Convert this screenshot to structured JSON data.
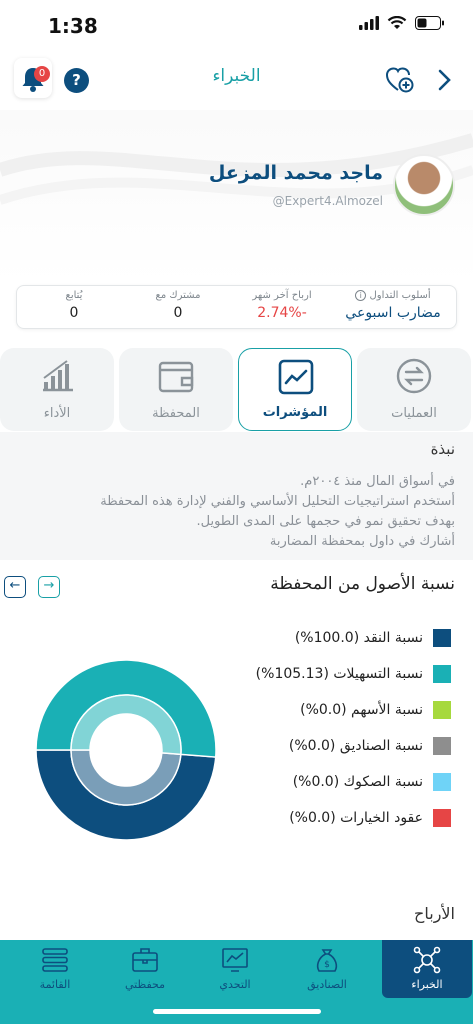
{
  "status_bar": {
    "time": "1:38"
  },
  "header": {
    "title": "الخبراء",
    "notification_count": "0",
    "help_label": "?"
  },
  "expert": {
    "name": "ماجد محمد المزعل",
    "handle": "@Expert4.Almozel"
  },
  "stats": [
    {
      "label": "أسلوب التداول",
      "value": "مضارب اسبوعي"
    },
    {
      "label": "ارباح آخر شهر",
      "value": "-2.74%"
    },
    {
      "label": "مشترك مع",
      "value": "0"
    },
    {
      "label": "يُتابع",
      "value": "0"
    }
  ],
  "tabs": [
    {
      "label": "العمليات",
      "icon": "exchange-icon"
    },
    {
      "label": "المؤشرات",
      "icon": "line-chart-icon",
      "active": true
    },
    {
      "label": "المحفظة",
      "icon": "wallet-icon"
    },
    {
      "label": "الأداء",
      "icon": "bar-chart-icon"
    }
  ],
  "bio": {
    "title": "نبذة",
    "lines": [
      "في أسواق المال منذ ٢٠٠٤م.",
      "أستخدم استراتيجيات التحليل الأساسي والفني لإدارة هذه المحفظة",
      "بهدف تحقيق نمو في حجمها على المدى الطويل.",
      "أشارك في داول بمحفظة المضاربة"
    ]
  },
  "assets": {
    "title": "نسبة الأصول من المحفظة",
    "prev_icon": "←",
    "next_icon": "→"
  },
  "chart_data": {
    "type": "pie",
    "title": "نسبة الأصول من المحفظة",
    "legend_position": "right",
    "series": [
      {
        "name": "نسبة النقد",
        "value": 100.0,
        "label": "نسبة النقد (100.0%)",
        "color": "#0d4e7e"
      },
      {
        "name": "نسبة التسهيلات",
        "value": 105.13,
        "label": "نسبة التسهيلات (105.13%)",
        "color": "#1ab0b5"
      },
      {
        "name": "نسبة الأسهم",
        "value": 0.0,
        "label": "نسبة الأسهم (0.0%)",
        "color": "#a6d93d"
      },
      {
        "name": "نسبة الصناديق",
        "value": 0.0,
        "label": "نسبة الصناديق (0.0%)",
        "color": "#8e8e8e"
      },
      {
        "name": "نسبة الصكوك",
        "value": 0.0,
        "label": "نسبة الصكوك (0.0%)",
        "color": "#6fd3f7"
      },
      {
        "name": "عقود الخيارات",
        "value": 0.0,
        "label": "عقود الخيارات (0.0%)",
        "color": "#e64545"
      }
    ]
  },
  "profits_title": "الأرباح",
  "tabbar": [
    {
      "label": "القائمة",
      "icon": "list-icon"
    },
    {
      "label": "محفظتي",
      "icon": "briefcase-icon"
    },
    {
      "label": "التحدي",
      "icon": "chart-screen-icon"
    },
    {
      "label": "الصناديق",
      "icon": "money-bag-icon"
    },
    {
      "label": "الخبراء",
      "icon": "network-icon",
      "active": true
    }
  ],
  "colors": {
    "brand_teal": "#1ab0b5",
    "brand_navy": "#0d4e7e",
    "negative": "#e64545"
  }
}
